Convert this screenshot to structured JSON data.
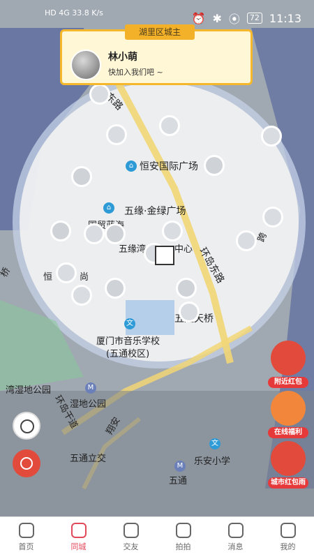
{
  "status": {
    "left": "HD 4G 33.8 K/s",
    "battery": "72",
    "time": "11:13"
  },
  "card": {
    "title": "湖里区城主",
    "name": "林小萌",
    "subtitle": "快加入我们吧 ~"
  },
  "map_labels": {
    "road1": "东路",
    "hengan": "恒安国际广场",
    "wuyuan": "五缘·金绿广场",
    "guomao": "国贸蓝海",
    "wuyuanwan": "五缘湾",
    "center": "中心",
    "huandao": "环岛东路",
    "wutong": "五通天桥",
    "school1": "厦门市音乐学校",
    "school2": "(五通校区)",
    "wetland": "湿地公园",
    "wetland2": "湾湿地公园",
    "huandao_gan": "环岛干道",
    "xianghe": "翔安",
    "wutong_jiao": "五通立交",
    "lean": "乐安小学",
    "wutong2": "五通",
    "heng": "恒",
    "shang": "尚",
    "qiao": "桥",
    "qiao2": "跨"
  },
  "side": {
    "red1": "附近红包",
    "red2": "在线福利",
    "red3": "城市红包雨"
  },
  "tabs": [
    "首页",
    "同城",
    "交友",
    "拍拍",
    "消息",
    "我的"
  ],
  "colors": {
    "accent": "#e2495a",
    "card_border": "#f5b72c"
  }
}
